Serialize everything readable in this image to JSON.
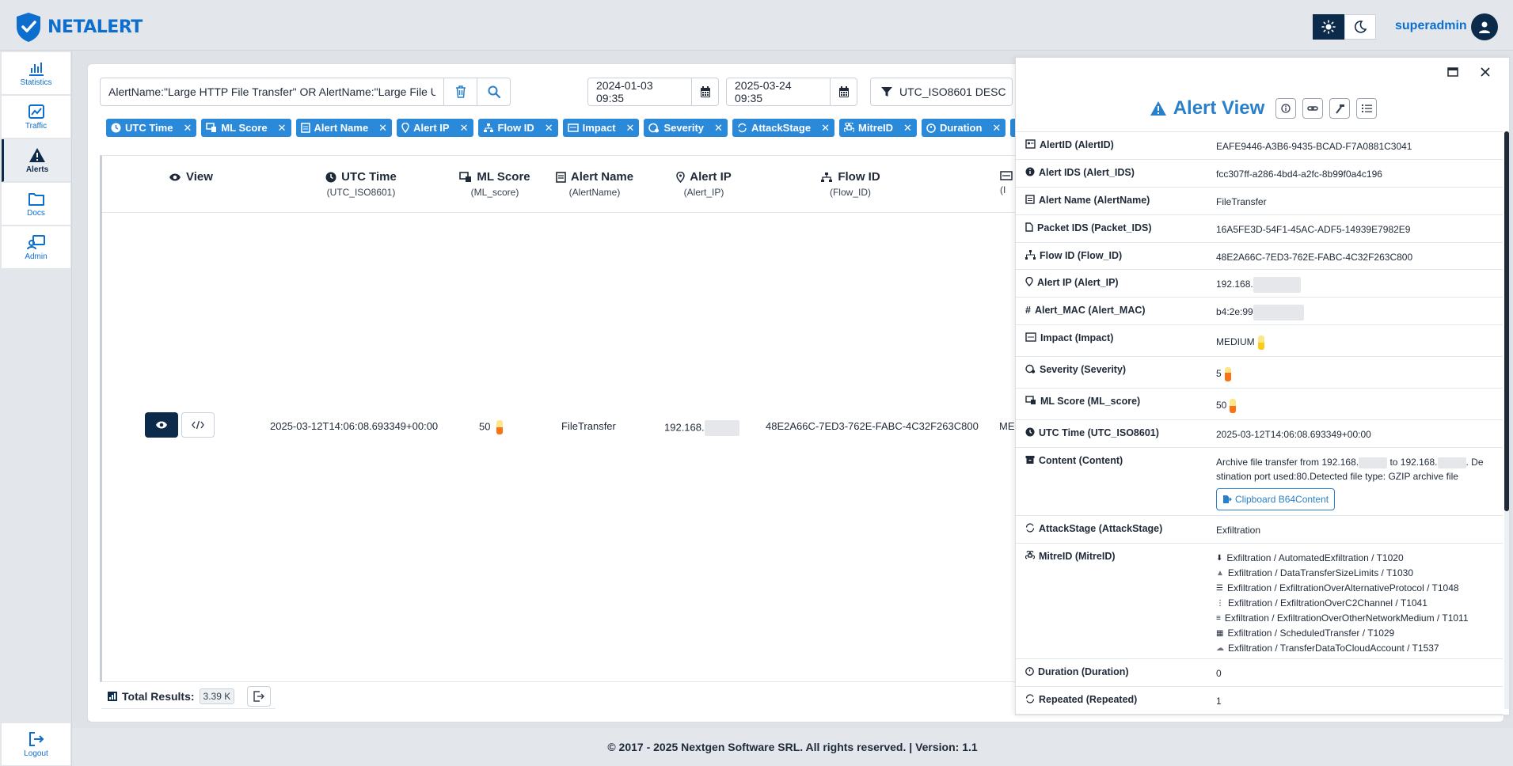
{
  "app": {
    "brand": "NETALERT",
    "user": "superadmin"
  },
  "sidebar": {
    "items": [
      {
        "label": "Statistics",
        "icon": "bar-chart-icon"
      },
      {
        "label": "Traffic",
        "icon": "line-chart-icon"
      },
      {
        "label": "Alerts",
        "icon": "warning-icon",
        "active": true
      },
      {
        "label": "Docs",
        "icon": "folder-icon"
      },
      {
        "label": "Admin",
        "icon": "admin-icon"
      }
    ],
    "logout": "Logout"
  },
  "toolbar": {
    "search_value": "AlertName:\"Large HTTP File Transfer\" OR AlertName:\"Large File Upload from in",
    "date_from": "2024-01-03 09:35",
    "date_to": "2025-03-24 09:35",
    "sort": "UTC_ISO8601 DESC"
  },
  "tags": [
    "UTC Time",
    "ML Score",
    "Alert Name",
    "Alert IP",
    "Flow ID",
    "Impact",
    "Severity",
    "AttackStage",
    "MitreID",
    "Duration",
    "Re"
  ],
  "table": {
    "columns": [
      {
        "title": "View",
        "sub": ""
      },
      {
        "title": "UTC Time",
        "sub": "(UTC_ISO8601)"
      },
      {
        "title": "ML Score",
        "sub": "(ML_score)"
      },
      {
        "title": "Alert Name",
        "sub": "(AlertName)"
      },
      {
        "title": "Alert IP",
        "sub": "(Alert_IP)"
      },
      {
        "title": "Flow ID",
        "sub": "(Flow_ID)"
      },
      {
        "title": "",
        "sub": "(I"
      }
    ],
    "row": {
      "utc": "2025-03-12T14:06:08.693349+00:00",
      "ml_score": "50",
      "ml_score_fraction": 0.5,
      "alert_name": "FileTransfer",
      "alert_ip": "192.168.",
      "flow_id": "48E2A66C-7ED3-762E-FABC-4C32F263C800",
      "impact": "MED"
    }
  },
  "footer_table": {
    "total_label": "Total Results:",
    "total_value": "3.39 K"
  },
  "footer": "© 2017 - 2025 Nextgen Software SRL. All rights reserved. | Version: 1.1",
  "alert_view": {
    "title": "Alert View",
    "fields": {
      "alertid": {
        "label": "AlertID (AlertID)",
        "value": "EAFE9446-A3B6-9435-BCAD-F7A0881C3041"
      },
      "alert_ids": {
        "label": "Alert IDS (Alert_IDS)",
        "value": "fcc307ff-a286-4bd4-a2fc-8b99f0a4c196"
      },
      "alertname": {
        "label": "Alert Name (AlertName)",
        "value": "FileTransfer"
      },
      "packet_ids": {
        "label": "Packet IDS (Packet_IDS)",
        "value": "16A5FE3D-54F1-45AC-ADF5-14939E7982E9"
      },
      "flow_id": {
        "label": "Flow ID (Flow_ID)",
        "value": "48E2A66C-7ED3-762E-FABC-4C32F263C800"
      },
      "alert_ip": {
        "label": "Alert IP (Alert_IP)",
        "value": "192.168."
      },
      "alert_mac": {
        "label": "Alert_MAC (Alert_MAC)",
        "value": "b4:2e:99"
      },
      "impact": {
        "label": "Impact (Impact)",
        "value": "MEDIUM",
        "level": 0.5
      },
      "severity": {
        "label": "Severity (Severity)",
        "value": "5",
        "level": 0.6
      },
      "ml_score": {
        "label": "ML Score (ML_score)",
        "value": "50",
        "level": 0.5
      },
      "utc": {
        "label": "UTC Time (UTC_ISO8601)",
        "value": "2025-03-12T14:06:08.693349+00:00"
      },
      "content": {
        "label": "Content (Content)",
        "part1": "Archive file transfer from 192.168.",
        "part2": "to 192.168.",
        "part3": ". De",
        "line2": "stination port used:80.Detected file type: GZIP archive file",
        "button": "Clipboard B64Content"
      },
      "attackstage": {
        "label": "AttackStage (AttackStage)",
        "value": "Exfiltration"
      },
      "mitreid": {
        "label": "MitreID (MitreID)",
        "items": [
          "Exfiltration / AutomatedExfiltration / T1020",
          "Exfiltration / DataTransferSizeLimits / T1030",
          "Exfiltration / ExfiltrationOverAlternativeProtocol / T1048",
          "Exfiltration / ExfiltrationOverC2Channel / T1041",
          "Exfiltration / ExfiltrationOverOtherNetworkMedium / T1011",
          "Exfiltration / ScheduledTransfer / T1029",
          "Exfiltration / TransferDataToCloudAccount / T1537"
        ]
      },
      "duration": {
        "label": "Duration (Duration)",
        "value": "0"
      },
      "repeated": {
        "label": "Repeated (Repeated)",
        "value": "1"
      }
    }
  },
  "colors": {
    "primary": "#0d6ecd",
    "dark": "#0c2a4a",
    "tag": "#2a89d8",
    "bar_fill": "#f97316",
    "bar_bg": "#fde68a"
  }
}
